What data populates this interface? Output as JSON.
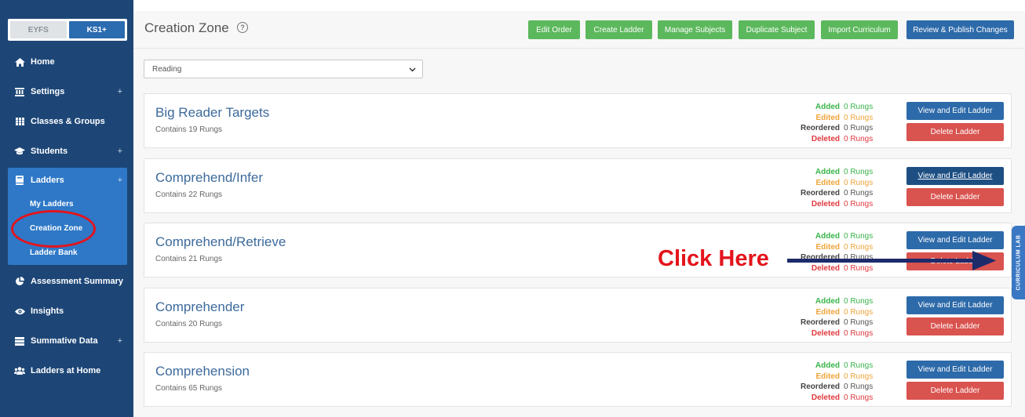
{
  "sidebar": {
    "levels": [
      "EYFS",
      "KS1+"
    ],
    "items": [
      {
        "label": "Home",
        "icon": "home-icon"
      },
      {
        "label": "Settings",
        "icon": "bank-icon",
        "expand": "+"
      },
      {
        "label": "Classes & Groups",
        "icon": "grid-icon"
      },
      {
        "label": "Students",
        "icon": "graduation-cap-icon",
        "expand": "+"
      },
      {
        "label": "Ladders",
        "icon": "book-icon",
        "expand": "+"
      },
      {
        "label": "Assessment Summary",
        "icon": "pie-chart-icon"
      },
      {
        "label": "Insights",
        "icon": "eye-icon"
      },
      {
        "label": "Summative Data",
        "icon": "server-icon",
        "expand": "+"
      },
      {
        "label": "Ladders at Home",
        "icon": "users-icon"
      }
    ],
    "ladder_subitems": [
      "My Ladders",
      "Creation Zone",
      "Ladder Bank"
    ]
  },
  "header": {
    "title": "Creation Zone",
    "help": "?",
    "buttons": [
      "Edit Order",
      "Create Ladder",
      "Manage Subjects",
      "Duplicate Subject",
      "Import Curriculum",
      "Review & Publish Changes"
    ]
  },
  "subject_select": {
    "value": "Reading"
  },
  "stat_labels": {
    "added": "Added",
    "edited": "Edited",
    "reordered": "Reordered",
    "deleted": "Deleted"
  },
  "action_labels": {
    "view": "View and Edit Ladder",
    "delete": "Delete Ladder"
  },
  "ladders": [
    {
      "title": "Big Reader Targets",
      "count": "Contains 19 Rungs",
      "added": "0 Rungs",
      "edited": "0 Rungs",
      "reordered": "0 Rungs",
      "deleted": "0 Rungs"
    },
    {
      "title": "Comprehend/Infer",
      "count": "Contains 22 Rungs",
      "added": "0 Rungs",
      "edited": "0 Rungs",
      "reordered": "0 Rungs",
      "deleted": "0 Rungs"
    },
    {
      "title": "Comprehend/Retrieve",
      "count": "Contains 21 Rungs",
      "added": "0 Rungs",
      "edited": "0 Rungs",
      "reordered": "0 Rungs",
      "deleted": "0 Rungs"
    },
    {
      "title": "Comprehender",
      "count": "Contains 20 Rungs",
      "added": "0 Rungs",
      "edited": "0 Rungs",
      "reordered": "0 Rungs",
      "deleted": "0 Rungs"
    },
    {
      "title": "Comprehension",
      "count": "Contains 65 Rungs",
      "added": "0 Rungs",
      "edited": "0 Rungs",
      "reordered": "0 Rungs",
      "deleted": "0 Rungs"
    }
  ],
  "side_tab": "CURRICULUM LAB",
  "annotation": {
    "text": "Click Here"
  },
  "colors": {
    "sidebar": "#1d4677",
    "active": "#2e78c7",
    "green_button": "#5cb85c",
    "blue_button": "#2d6aa9",
    "delete_button": "#d9534f",
    "annotation": "#e3141c"
  }
}
